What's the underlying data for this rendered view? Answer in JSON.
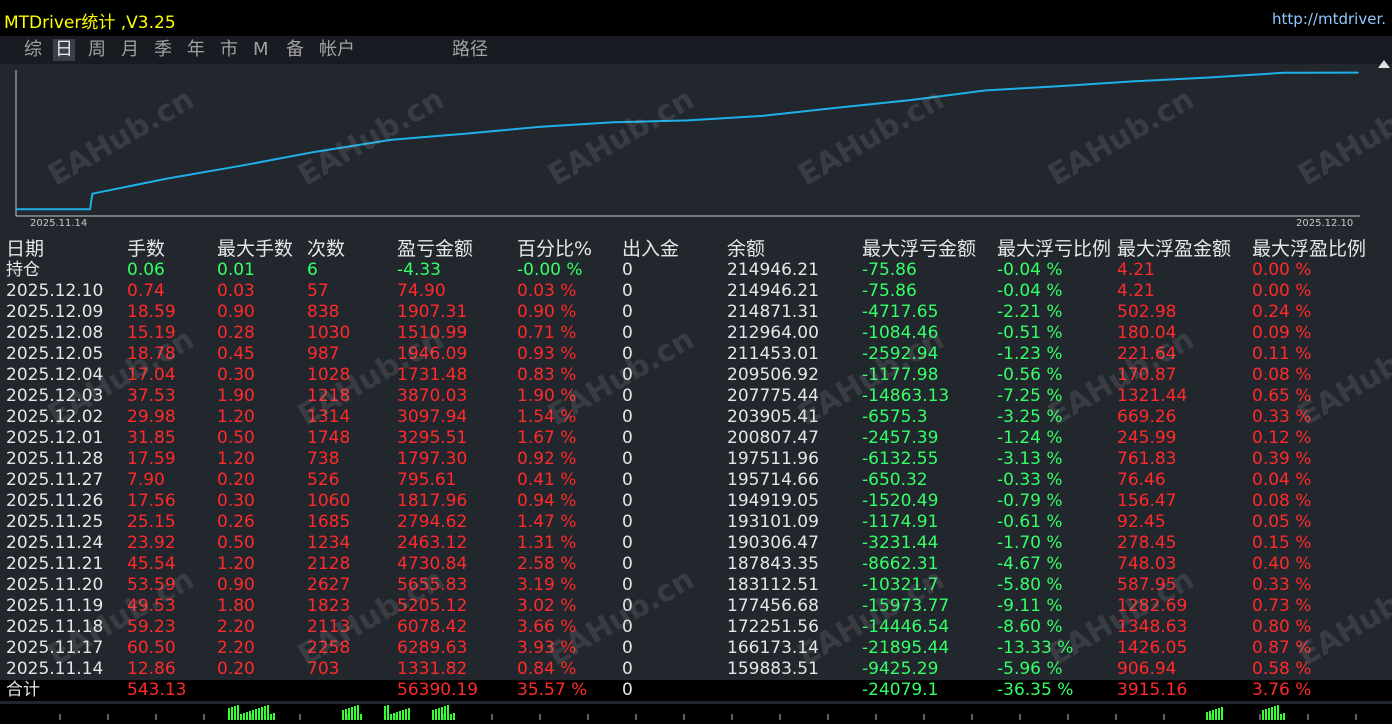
{
  "app": {
    "title": "MTDriver统计 ,V3.25",
    "url": "http://mtdriver."
  },
  "tabs": [
    {
      "label": "综",
      "active": false
    },
    {
      "label": "日",
      "active": true
    },
    {
      "label": "周",
      "active": false
    },
    {
      "label": "月",
      "active": false
    },
    {
      "label": "季",
      "active": false
    },
    {
      "label": "年",
      "active": false
    },
    {
      "label": "市",
      "active": false
    },
    {
      "label": "M",
      "active": false
    },
    {
      "label": "备",
      "active": false
    },
    {
      "label": "帐户",
      "active": false
    },
    {
      "label": "路径",
      "active": false
    }
  ],
  "chart": {
    "x_start_label": "2025.11.14",
    "x_end_label": "2025.12.10",
    "line_color": "#1fb0e8"
  },
  "table": {
    "headers": [
      "日期",
      "手数",
      "最大手数",
      "次数",
      "盈亏金额",
      "百分比%",
      "出入金",
      "余额",
      "最大浮亏金额",
      "最大浮亏比例",
      "最大浮盈金额",
      "最大浮盈比例"
    ],
    "open": [
      "持仓",
      "0.06",
      "0.01",
      "6",
      "-4.33",
      "-0.00 %",
      "0",
      "214946.21",
      "-75.86",
      "-0.04 %",
      "4.21",
      "0.00 %"
    ],
    "rows": [
      [
        "2025.12.10",
        "0.74",
        "0.03",
        "57",
        "74.90",
        "0.03 %",
        "0",
        "214946.21",
        "-75.86",
        "-0.04 %",
        "4.21",
        "0.00 %"
      ],
      [
        "2025.12.09",
        "18.59",
        "0.90",
        "838",
        "1907.31",
        "0.90 %",
        "0",
        "214871.31",
        "-4717.65",
        "-2.21 %",
        "502.98",
        "0.24 %"
      ],
      [
        "2025.12.08",
        "15.19",
        "0.28",
        "1030",
        "1510.99",
        "0.71 %",
        "0",
        "212964.00",
        "-1084.46",
        "-0.51 %",
        "180.04",
        "0.09 %"
      ],
      [
        "2025.12.05",
        "18.78",
        "0.45",
        "987",
        "1946.09",
        "0.93 %",
        "0",
        "211453.01",
        "-2592.94",
        "-1.23 %",
        "221.64",
        "0.11 %"
      ],
      [
        "2025.12.04",
        "17.04",
        "0.30",
        "1028",
        "1731.48",
        "0.83 %",
        "0",
        "209506.92",
        "-1177.98",
        "-0.56 %",
        "170.87",
        "0.08 %"
      ],
      [
        "2025.12.03",
        "37.53",
        "1.90",
        "1218",
        "3870.03",
        "1.90 %",
        "0",
        "207775.44",
        "-14863.13",
        "-7.25 %",
        "1321.44",
        "0.65 %"
      ],
      [
        "2025.12.02",
        "29.98",
        "1.20",
        "1314",
        "3097.94",
        "1.54 %",
        "0",
        "203905.41",
        "-6575.3",
        "-3.25 %",
        "669.26",
        "0.33 %"
      ],
      [
        "2025.12.01",
        "31.85",
        "0.50",
        "1748",
        "3295.51",
        "1.67 %",
        "0",
        "200807.47",
        "-2457.39",
        "-1.24 %",
        "245.99",
        "0.12 %"
      ],
      [
        "2025.11.28",
        "17.59",
        "1.20",
        "738",
        "1797.30",
        "0.92 %",
        "0",
        "197511.96",
        "-6132.55",
        "-3.13 %",
        "761.83",
        "0.39 %"
      ],
      [
        "2025.11.27",
        "7.90",
        "0.20",
        "526",
        "795.61",
        "0.41 %",
        "0",
        "195714.66",
        "-650.32",
        "-0.33 %",
        "76.46",
        "0.04 %"
      ],
      [
        "2025.11.26",
        "17.56",
        "0.30",
        "1060",
        "1817.96",
        "0.94 %",
        "0",
        "194919.05",
        "-1520.49",
        "-0.79 %",
        "156.47",
        "0.08 %"
      ],
      [
        "2025.11.25",
        "25.15",
        "0.26",
        "1685",
        "2794.62",
        "1.47 %",
        "0",
        "193101.09",
        "-1174.91",
        "-0.61 %",
        "92.45",
        "0.05 %"
      ],
      [
        "2025.11.24",
        "23.92",
        "0.50",
        "1234",
        "2463.12",
        "1.31 %",
        "0",
        "190306.47",
        "-3231.44",
        "-1.70 %",
        "278.45",
        "0.15 %"
      ],
      [
        "2025.11.21",
        "45.54",
        "1.20",
        "2128",
        "4730.84",
        "2.58 %",
        "0",
        "187843.35",
        "-8662.31",
        "-4.67 %",
        "748.03",
        "0.40 %"
      ],
      [
        "2025.11.20",
        "53.59",
        "0.90",
        "2627",
        "5655.83",
        "3.19 %",
        "0",
        "183112.51",
        "-10321.7",
        "-5.80 %",
        "587.95",
        "0.33 %"
      ],
      [
        "2025.11.19",
        "49.53",
        "1.80",
        "1823",
        "5205.12",
        "3.02 %",
        "0",
        "177456.68",
        "-15973.77",
        "-9.11 %",
        "1282.69",
        "0.73 %"
      ],
      [
        "2025.11.18",
        "59.23",
        "2.20",
        "2113",
        "6078.42",
        "3.66 %",
        "0",
        "172251.56",
        "-14446.54",
        "-8.60 %",
        "1348.63",
        "0.80 %"
      ],
      [
        "2025.11.17",
        "60.50",
        "2.20",
        "2258",
        "6289.63",
        "3.93 %",
        "0",
        "166173.14",
        "-21895.44",
        "-13.33 %",
        "1426.05",
        "0.87 %"
      ],
      [
        "2025.11.14",
        "12.86",
        "0.20",
        "703",
        "1331.82",
        "0.84 %",
        "0",
        "159883.51",
        "-9425.29",
        "-5.96 %",
        "906.94",
        "0.58 %"
      ]
    ],
    "total": [
      "合计",
      "543.13",
      "",
      "",
      "56390.19",
      "35.57 %",
      "0",
      "",
      "-24079.1",
      "-36.35 %",
      "3915.16",
      "3.76 %"
    ]
  },
  "watermark": "EAHub.cn",
  "colors": {
    "profit": "#ff2a2a",
    "loss": "#33ff66",
    "text": "#e6e6e6",
    "title": "#ffff00"
  },
  "chart_data": {
    "type": "line",
    "x": [
      "2025.11.14",
      "2025.11.17",
      "2025.11.18",
      "2025.11.19",
      "2025.11.20",
      "2025.11.21",
      "2025.11.24",
      "2025.11.25",
      "2025.11.26",
      "2025.11.27",
      "2025.11.28",
      "2025.12.01",
      "2025.12.02",
      "2025.12.03",
      "2025.12.04",
      "2025.12.05",
      "2025.12.08",
      "2025.12.09",
      "2025.12.10"
    ],
    "series": [
      {
        "values": [
          159883.51,
          166173.14,
          172251.56,
          177456.68,
          183112.51,
          187843.35,
          190306.47,
          193101.09,
          194919.05,
          195714.66,
          197511.96,
          200807.47,
          203905.41,
          207775.44,
          209506.92,
          211453.01,
          212964.0,
          214871.31,
          214946.21
        ]
      }
    ],
    "x_start_label": "2025.11.14",
    "x_end_label": "2025.12.10",
    "ylim": [
      158000,
      216000
    ]
  }
}
